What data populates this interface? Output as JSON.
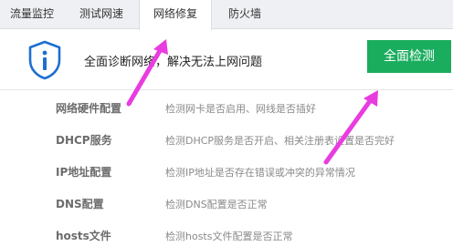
{
  "tabs": [
    {
      "label": "流量监控"
    },
    {
      "label": "测试网速"
    },
    {
      "label": "网络修复"
    },
    {
      "label": "防火墙"
    }
  ],
  "header": {
    "description": "全面诊断网络，解决无法上网问题",
    "scan_button": "全面检测"
  },
  "checks": [
    {
      "name": "网络硬件配置",
      "desc": "检测网卡是否启用、网线是否插好"
    },
    {
      "name": "DHCP服务",
      "desc": "检测DHCP服务是否开启、相关注册表设置是否完好"
    },
    {
      "name": "IP地址配置",
      "desc": "检测IP地址是否存在错误或冲突的异常情况"
    },
    {
      "name": "DNS配置",
      "desc": "检测DNS配置是否正常"
    },
    {
      "name": "hosts文件",
      "desc": "检测hosts文件配置是否正常"
    }
  ],
  "colors": {
    "accent_green": "#1aad5e",
    "shield_blue": "#1e6fd0",
    "annotation_arrow": "#e93ce0"
  }
}
